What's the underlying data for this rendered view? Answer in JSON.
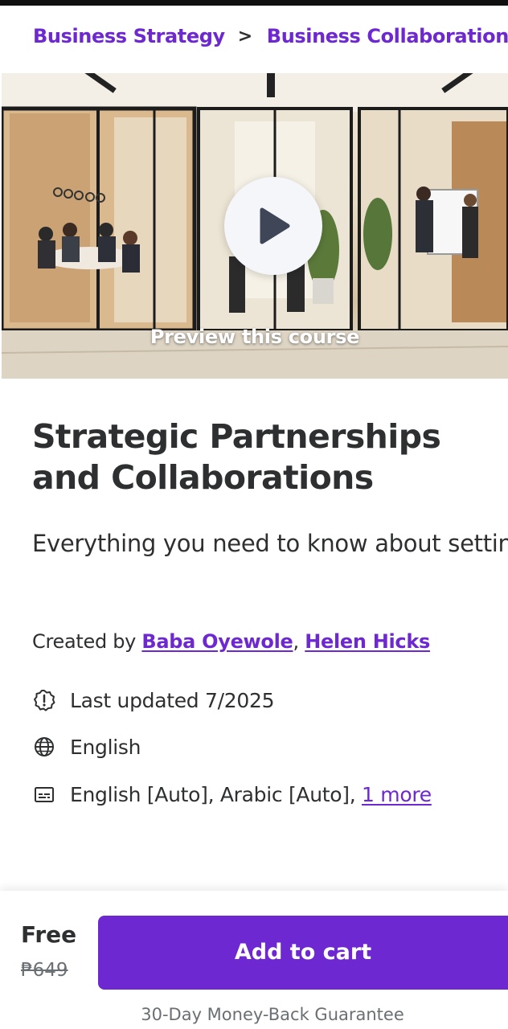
{
  "breadcrumb": {
    "items": [
      "Business Strategy",
      "Business Collaboration"
    ],
    "separator": ">"
  },
  "preview": {
    "label": "Preview this course",
    "play_icon": "play-icon"
  },
  "course": {
    "title": "Strategic Partnerships and Collaborations",
    "subtitle": "Everything you need to know about setting up partnerships and collaborations",
    "created_by_label": "Created by",
    "authors": [
      "Baba Oyewole",
      "Helen Hicks"
    ],
    "author_separator": ",",
    "last_updated": "Last updated 7/2025",
    "language": "English",
    "captions": "English [Auto], Arabic [Auto],",
    "captions_more": "1 more",
    "icons": {
      "last_updated": "alert-badge-icon",
      "language": "globe-icon",
      "captions": "closed-captions-icon"
    }
  },
  "purchase": {
    "price": "Free",
    "original_price": "₱649",
    "add_to_cart": "Add to cart",
    "guarantee": "30-Day Money-Back Guarantee"
  },
  "colors": {
    "accent": "#6d28d2",
    "text": "#2d2f31",
    "muted": "#6a6f73"
  }
}
